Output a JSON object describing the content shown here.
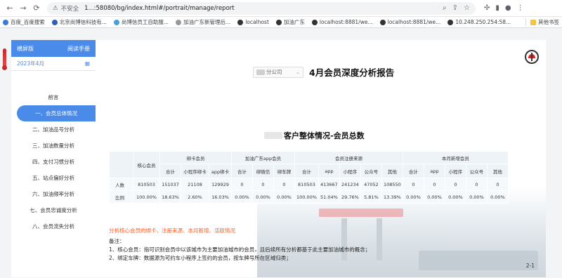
{
  "browser": {
    "security_label": "不安全",
    "url": "1...:58080/bg/index.html#/portrait/manage/report",
    "bookmarks": [
      "百度_百度搜索",
      "北京尚博信科技有...",
      "尚博信员工自助服...",
      "加油广东新管理后...",
      "localhost",
      "加油广东",
      "localhost:8881/we...",
      "localhost:8881/we...",
      "10.248.250.254:58..."
    ],
    "other_bookmarks": "其他书签"
  },
  "sidebar": {
    "title": "横屏版",
    "manual": "阅读手册",
    "month": "2023年4月",
    "items": [
      {
        "label": "前言"
      },
      {
        "label": "一、会员总体情况"
      },
      {
        "label": "二、加油品号分析"
      },
      {
        "label": "三、加油数量分析"
      },
      {
        "label": "四、支付习惯分析"
      },
      {
        "label": "五、站点偏好分析"
      },
      {
        "label": "六、加油频率分析"
      },
      {
        "label": "七、会员忠诚度分析"
      },
      {
        "label": "八、会员流失分析"
      }
    ]
  },
  "header": {
    "company": "分公司",
    "report_title": "4月会员深度分析报告"
  },
  "section": {
    "title": "客户整体情况-会员总数"
  },
  "table": {
    "core_label": "核心会员",
    "groups": [
      "绑卡会员",
      "加油广东app会员",
      "会员注册来源",
      "本月新增会员"
    ],
    "subheaders": [
      "合计",
      "小程序绑卡",
      "app绑卡",
      "合计",
      "绑微信",
      "绑车牌",
      "合计",
      "app",
      "小程序",
      "公众号",
      "其他",
      "合计",
      "app",
      "小程序",
      "公众号",
      "其他"
    ],
    "rows": [
      {
        "label": "人数",
        "core": "810503",
        "cells": [
          "151037",
          "21108",
          "129929",
          "0",
          "0",
          "0",
          "810503",
          "413667",
          "241234",
          "47052",
          "108550",
          "0",
          "0",
          "0",
          "0",
          "0"
        ]
      },
      {
        "label": "比例",
        "core": "100.00%",
        "cells": [
          "18.63%",
          "2.60%",
          "16.03%",
          "0.00%",
          "0.00%",
          "0.00%",
          "100.00%",
          "51.04%",
          "29.76%",
          "5.81%",
          "13.39%",
          "0.00%",
          "0.00%",
          "0.00%",
          "0.00%",
          "0.00%"
        ]
      }
    ]
  },
  "analysis": "分析核心会员的绑卡、注册来源、本月新增、活跃情况",
  "notes": {
    "title": "备注：",
    "lines": [
      "1、核心会员：指可识别会员中以该城市为主要加油城市的会员，且后续所有分析都基于此主要加油城市的概念；",
      "2、绑定车牌：数据源为可约车小程序上签约的会员，按车牌号所在区域归类；"
    ]
  },
  "page_number": "2-1",
  "colors": {
    "accent": "#4a8ae9",
    "highlight": "#ff5a1f"
  }
}
